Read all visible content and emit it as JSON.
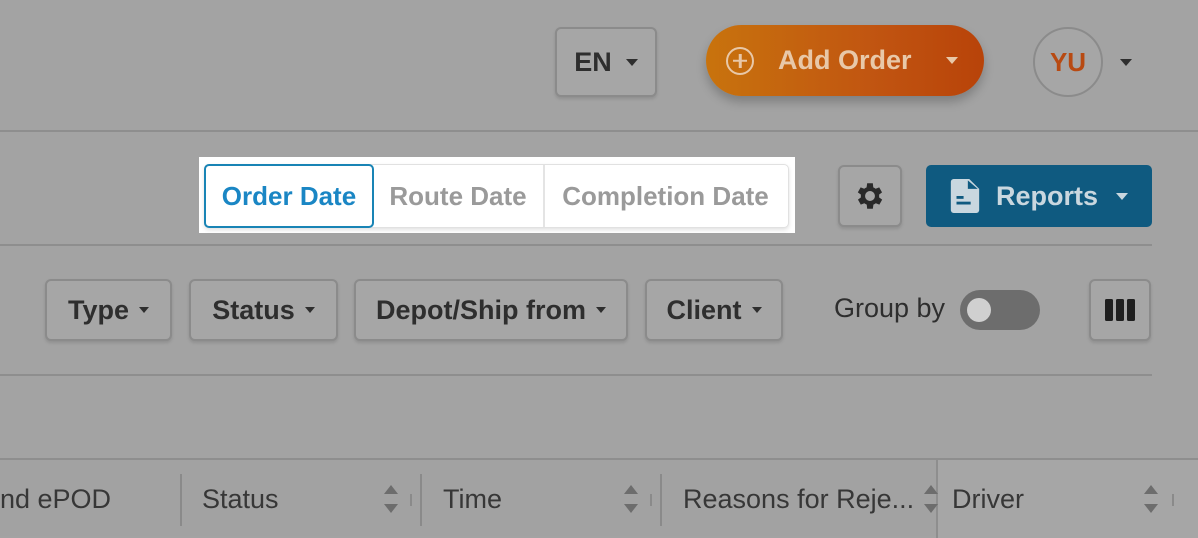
{
  "header": {
    "language": "EN",
    "add_order_label": "Add Order",
    "avatar_initials": "YU"
  },
  "date_filter": {
    "options": [
      "Order Date",
      "Route Date",
      "Completion Date"
    ],
    "selected": "Order Date"
  },
  "toolbar": {
    "reports_label": "Reports",
    "settings_icon": "gear-icon",
    "reports_icon": "document-icon"
  },
  "filters": {
    "type": "Type",
    "status": "Status",
    "depot": "Depot/Ship from",
    "client": "Client",
    "group_by_label": "Group by",
    "group_by_on": false
  },
  "table": {
    "columns": [
      "nd ePOD",
      "Status",
      "Time",
      "Reasons for Reje...",
      "Driver"
    ]
  },
  "colors": {
    "accent_blue": "#1a86c4",
    "add_order_orange": "#c15511",
    "reports_blue": "#0f5a80"
  }
}
